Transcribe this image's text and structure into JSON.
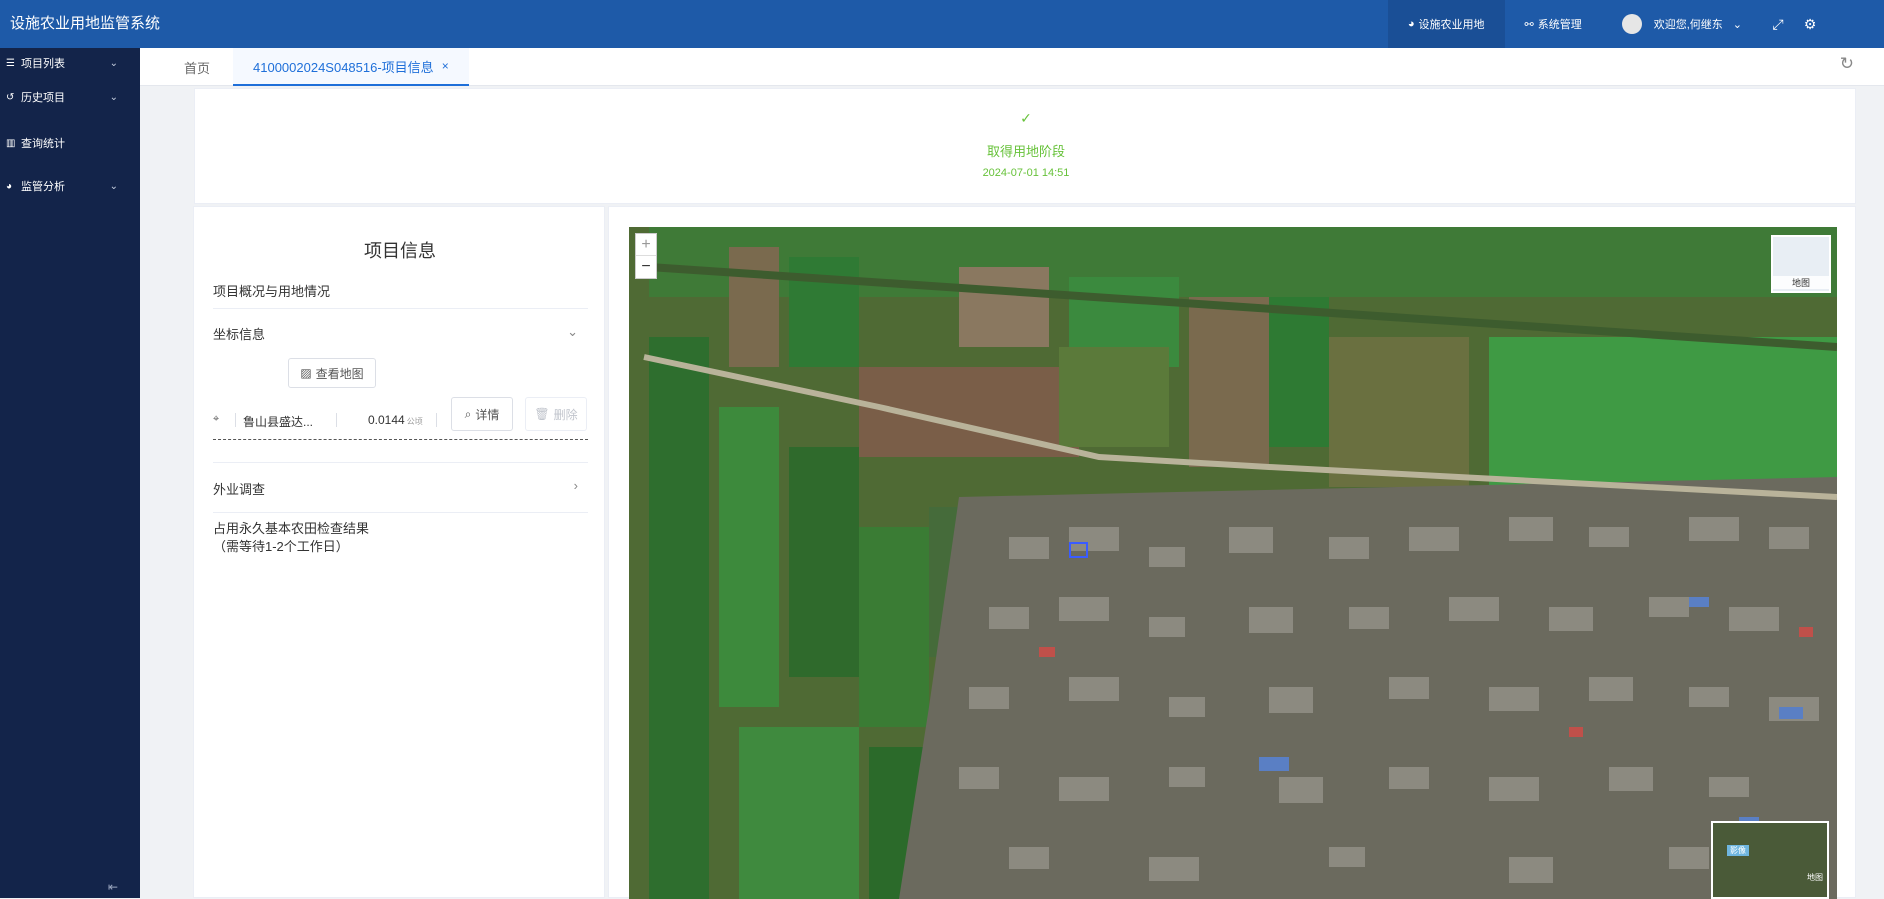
{
  "app": {
    "title": "设施农业用地监管系统"
  },
  "header": {
    "nav_active": "设施农业用地",
    "nav_system": "系统管理",
    "welcome": "欢迎您,何继东"
  },
  "sidebar": {
    "items": [
      {
        "label": "项目列表"
      },
      {
        "label": "历史项目"
      },
      {
        "label": "查询统计"
      },
      {
        "label": "监管分析"
      }
    ]
  },
  "tabs": {
    "home": "首页",
    "active": "4100002024S048516-项目信息"
  },
  "stage": {
    "name": "取得用地阶段",
    "time": "2024-07-01 14:51"
  },
  "info": {
    "title": "项目信息",
    "overview": "项目概况与用地情况",
    "coord_section": "坐标信息",
    "view_map": "查看地图",
    "coord_name": "鲁山县盛达...",
    "coord_area": "0.0144",
    "coord_unit": "公顷",
    "detail": "详情",
    "delete": "删除",
    "field_survey": "外业调查",
    "check_result": "占用永久基本农田检查结果",
    "check_note": "（需等待1-2个工作日）"
  },
  "map": {
    "zoom_in": "+",
    "zoom_out": "−",
    "basemap_label": "地图",
    "overview_tag": "影像",
    "overview_label": "地图"
  }
}
